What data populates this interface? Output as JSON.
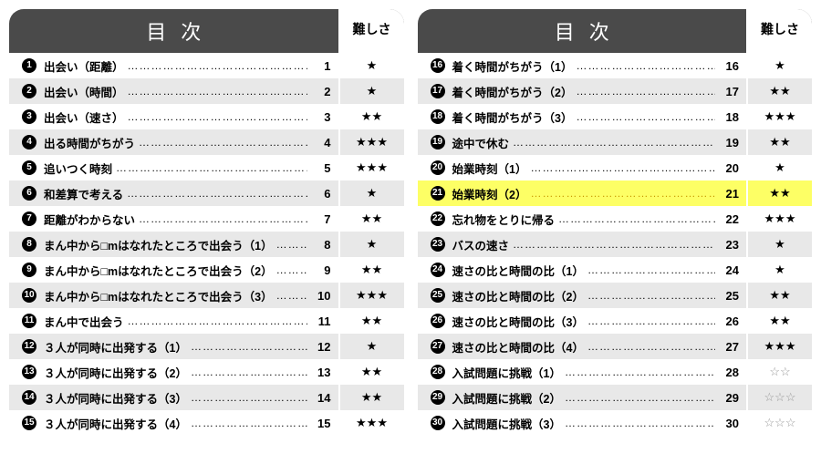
{
  "header": {
    "toc": "目次",
    "difficulty": "難しさ"
  },
  "panels": [
    {
      "rows": [
        {
          "n": 1,
          "title": "出会い（距離）",
          "page": 1,
          "stars": 1,
          "open": false
        },
        {
          "n": 2,
          "title": "出会い（時間）",
          "page": 2,
          "stars": 1,
          "open": false
        },
        {
          "n": 3,
          "title": "出会い（速さ）",
          "page": 3,
          "stars": 2,
          "open": false
        },
        {
          "n": 4,
          "title": "出る時間がちがう",
          "page": 4,
          "stars": 3,
          "open": false
        },
        {
          "n": 5,
          "title": "追いつく時刻",
          "page": 5,
          "stars": 3,
          "open": false
        },
        {
          "n": 6,
          "title": "和差算で考える",
          "page": 6,
          "stars": 1,
          "open": false
        },
        {
          "n": 7,
          "title": "距離がわからない",
          "page": 7,
          "stars": 2,
          "open": false
        },
        {
          "n": 8,
          "title": "まん中から□mはなれたところで出会う（1）",
          "page": 8,
          "stars": 1,
          "open": false
        },
        {
          "n": 9,
          "title": "まん中から□mはなれたところで出会う（2）",
          "page": 9,
          "stars": 2,
          "open": false
        },
        {
          "n": 10,
          "title": "まん中から□mはなれたところで出会う（3）",
          "page": 10,
          "stars": 3,
          "open": false
        },
        {
          "n": 11,
          "title": "まん中で出会う",
          "page": 11,
          "stars": 2,
          "open": false
        },
        {
          "n": 12,
          "title": "３人が同時に出発する（1）",
          "page": 12,
          "stars": 1,
          "open": false
        },
        {
          "n": 13,
          "title": "３人が同時に出発する（2）",
          "page": 13,
          "stars": 2,
          "open": false
        },
        {
          "n": 14,
          "title": "３人が同時に出発する（3）",
          "page": 14,
          "stars": 2,
          "open": false
        },
        {
          "n": 15,
          "title": "３人が同時に出発する（4）",
          "page": 15,
          "stars": 3,
          "open": false
        }
      ]
    },
    {
      "rows": [
        {
          "n": 16,
          "title": "着く時間がちがう（1）",
          "page": 16,
          "stars": 1,
          "open": false
        },
        {
          "n": 17,
          "title": "着く時間がちがう（2）",
          "page": 17,
          "stars": 2,
          "open": false
        },
        {
          "n": 18,
          "title": "着く時間がちがう（3）",
          "page": 18,
          "stars": 3,
          "open": false
        },
        {
          "n": 19,
          "title": "途中で休む",
          "page": 19,
          "stars": 2,
          "open": false
        },
        {
          "n": 20,
          "title": "始業時刻（1）",
          "page": 20,
          "stars": 1,
          "open": false
        },
        {
          "n": 21,
          "title": "始業時刻（2）",
          "page": 21,
          "stars": 2,
          "open": false,
          "highlight": true
        },
        {
          "n": 22,
          "title": "忘れ物をとりに帰る",
          "page": 22,
          "stars": 3,
          "open": false
        },
        {
          "n": 23,
          "title": "バスの速さ",
          "page": 23,
          "stars": 1,
          "open": false
        },
        {
          "n": 24,
          "title": "速さの比と時間の比（1）",
          "page": 24,
          "stars": 1,
          "open": false
        },
        {
          "n": 25,
          "title": "速さの比と時間の比（2）",
          "page": 25,
          "stars": 2,
          "open": false
        },
        {
          "n": 26,
          "title": "速さの比と時間の比（3）",
          "page": 26,
          "stars": 2,
          "open": false
        },
        {
          "n": 27,
          "title": "速さの比と時間の比（4）",
          "page": 27,
          "stars": 3,
          "open": false
        },
        {
          "n": 28,
          "title": "入試問題に挑戦（1）",
          "page": 28,
          "stars": 2,
          "open": true
        },
        {
          "n": 29,
          "title": "入試問題に挑戦（2）",
          "page": 29,
          "stars": 3,
          "open": true
        },
        {
          "n": 30,
          "title": "入試問題に挑戦（3）",
          "page": 30,
          "stars": 3,
          "open": true
        }
      ]
    }
  ]
}
